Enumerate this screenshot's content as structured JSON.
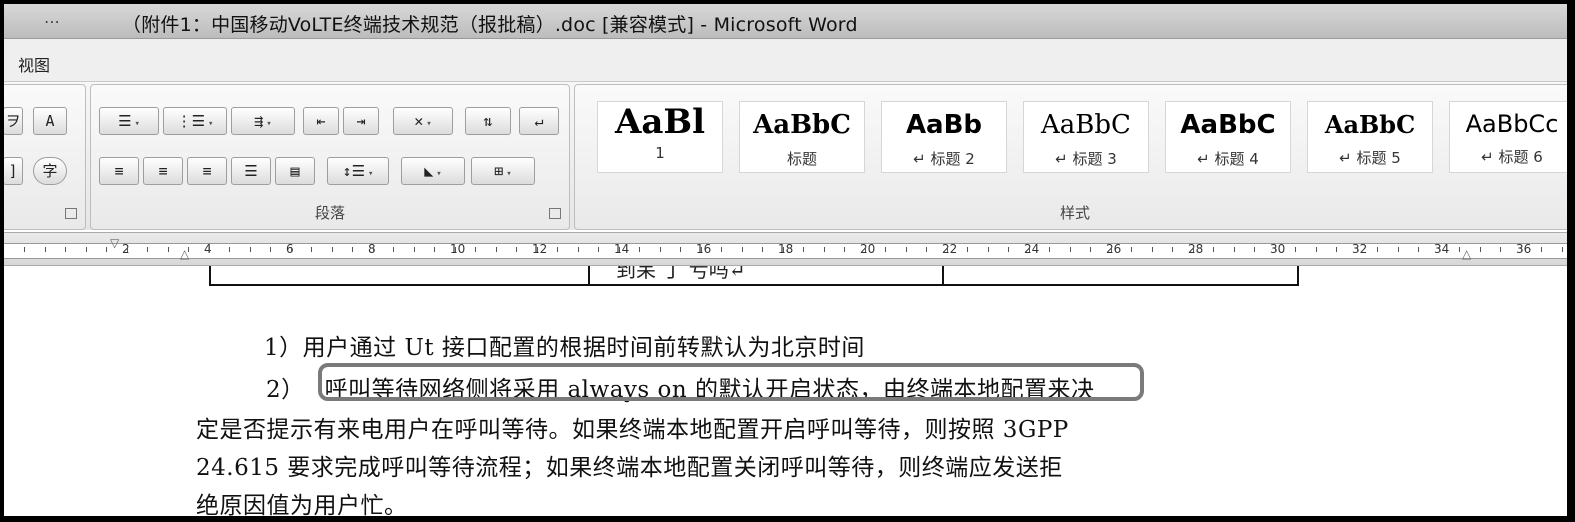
{
  "window": {
    "title": "（附件1：中国移动VoLTE终端技术规范（报批稿）.doc [兼容模式] - Microsoft Word"
  },
  "menu": {
    "view_tab": "视图"
  },
  "ribbon": {
    "font_group": {
      "char_border_btn": "A",
      "enclose_char_btn": "字"
    },
    "paragraph_group": {
      "label": "段落"
    },
    "styles_group": {
      "label": "样式",
      "items": [
        {
          "sample": "AaBl",
          "name": "1"
        },
        {
          "sample": "AaBbC",
          "name": "标题"
        },
        {
          "sample": "AaBb",
          "name": "↵ 标题 2"
        },
        {
          "sample": "AaBbC",
          "name": "↵ 标题 3"
        },
        {
          "sample": "AaBbC",
          "name": "↵ 标题 4"
        },
        {
          "sample": "AaBbC",
          "name": "↵ 标题 5"
        },
        {
          "sample": "AaBbCc",
          "name": "↵ 标题 6"
        }
      ]
    }
  },
  "ruler": {
    "labels": [
      "2",
      "4",
      "6",
      "8",
      "10",
      "12",
      "14",
      "16",
      "18",
      "20",
      "22",
      "24",
      "26",
      "28",
      "30",
      "32",
      "34",
      "36"
    ]
  },
  "document": {
    "table_fragment": "到呆 丁 亏吗↵",
    "para1": "1）用户通过 Ut 接口配置的根据时间前转默认为北京时间",
    "para2_prefix": "2）",
    "para2_highlight": "呼叫等待网络侧将采用 always on 的默认开启状态，",
    "para2_rest": "由终端本地配置来决",
    "para2_line2": "定是否提示有来电用户在呼叫等待。如果终端本地配置开启呼叫等待，则按照 3GPP",
    "para2_line3": "24.615 要求完成呼叫等待流程；如果终端本地配置关闭呼叫等待，则终端应发送拒",
    "para2_line4": "绝原因值为用户忙。"
  }
}
